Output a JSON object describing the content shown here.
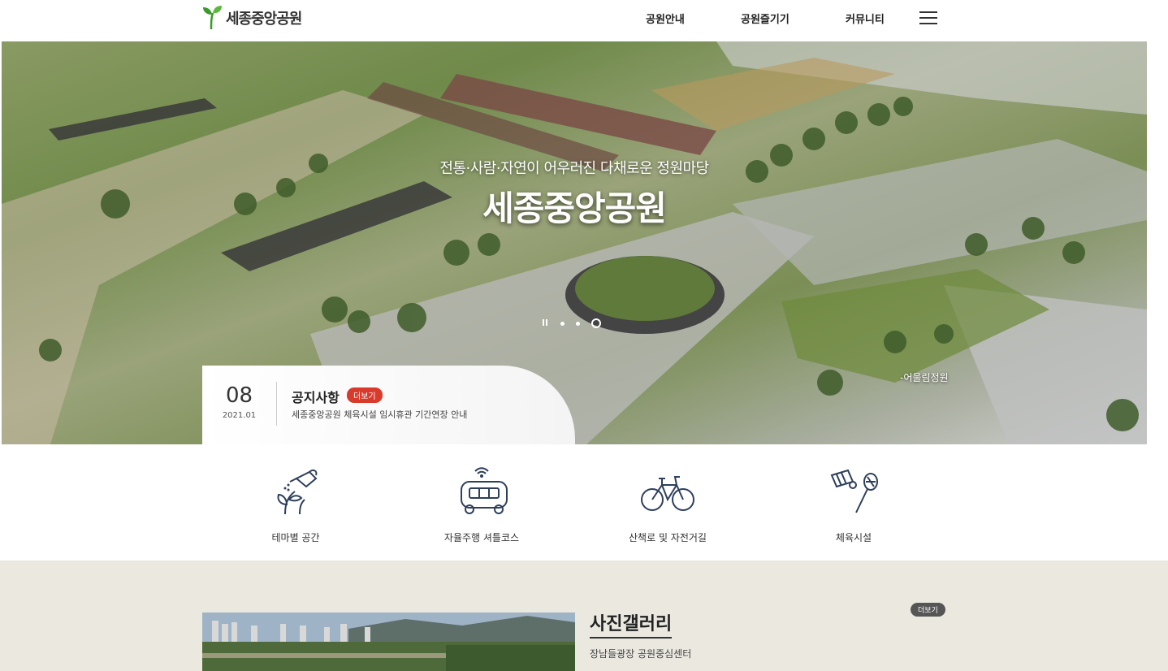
{
  "header": {
    "logo_text": "세종중앙공원",
    "nav": [
      "공원안내",
      "공원즐기기",
      "커뮤니티"
    ]
  },
  "hero": {
    "subtitle": "전통·사람·자연이 어우러진 다채로운 정원마당",
    "title": "세종중앙공원",
    "caption": "-어울림정원"
  },
  "notice": {
    "day": "08",
    "year_month": "2021.01",
    "title": "공지사항",
    "more_label": "더보기",
    "text": "세종중앙공원 체육시설 임시휴관 기간연장 안내"
  },
  "quick_links": [
    {
      "label": "테마별 공간",
      "icon": "watering-can-icon"
    },
    {
      "label": "자율주행 셔틀코스",
      "icon": "shuttle-bus-icon"
    },
    {
      "label": "산책로 및 자전거길",
      "icon": "bicycle-icon"
    },
    {
      "label": "체육시설",
      "icon": "badminton-icon"
    }
  ],
  "gallery": {
    "title": "사진갤러리",
    "more_label": "더보기",
    "description": "장남들광장 공원중심센터"
  },
  "colors": {
    "accent_red": "#d83a2c",
    "logo_green": "#3a9a2a",
    "gallery_bg": "#ebe8e0",
    "icon_navy": "#2d3f5c"
  }
}
